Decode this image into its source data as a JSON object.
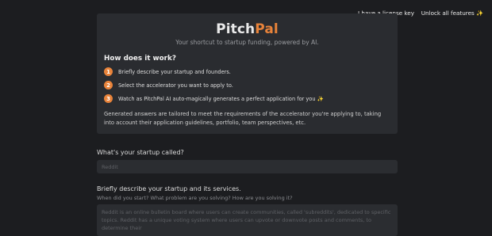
{
  "nav": {
    "license_label": "I have a license key",
    "unlock_label": "Unlock all features",
    "unlock_icon": "✨"
  },
  "brand": {
    "name_part1": "Pitch",
    "name_part2": "Pal",
    "tagline": "Your shortcut to startup funding, powered by AI.",
    "accent_color": "#e8833a"
  },
  "how": {
    "title": "How does it work?",
    "steps": [
      {
        "num": "1",
        "text": "Briefly describe your startup and founders."
      },
      {
        "num": "2",
        "text": "Select the accelerator you want to apply to."
      },
      {
        "num": "3",
        "text": "Watch as PitchPal AI auto-magically generates a perfect application for you ✨"
      }
    ],
    "note": "Generated answers are tailored to meet the requirements of the accelerator you're applying to, taking into account their application guidelines, portfolio, team perspectives, etc."
  },
  "form": {
    "startup_name": {
      "label": "What's your startup called?",
      "placeholder": "Reddit",
      "value": ""
    },
    "description": {
      "label": "Briefly describe your startup and its services.",
      "hint": "When did you start? What problem are you solving? How are you solving it?",
      "placeholder": "Reddit is an online bulletin board where users can create communities, called 'subreddits', dedicated to specific topics. Reddit has a unique voting system where users can upvote or downvote posts and comments, to determine their",
      "value": ""
    }
  }
}
